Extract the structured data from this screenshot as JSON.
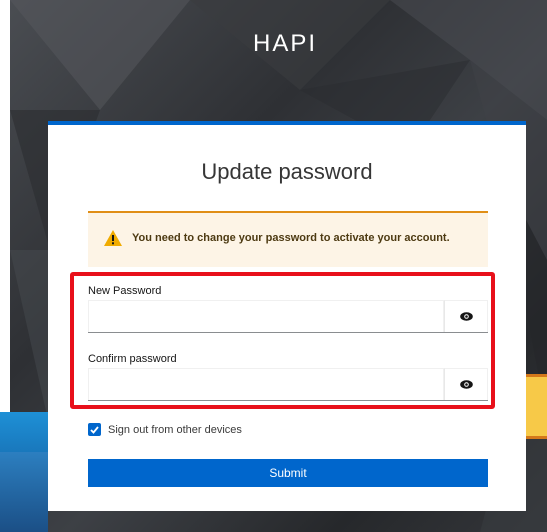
{
  "brand": {
    "name": "HAPI"
  },
  "card": {
    "title": "Update password",
    "alert": {
      "icon": "warning-triangle-icon",
      "message": "You need to change your password to activate your account.",
      "color": "#e08e16"
    },
    "fields": [
      {
        "label": "New Password",
        "value": "",
        "toggle_icon": "eye-icon"
      },
      {
        "label": "Confirm password",
        "value": "",
        "toggle_icon": "eye-icon"
      }
    ],
    "checkbox": {
      "label": "Sign out from other devices",
      "checked": true
    },
    "submit_label": "Submit",
    "accent": "#0066cc",
    "highlight_color": "#e8101a"
  }
}
